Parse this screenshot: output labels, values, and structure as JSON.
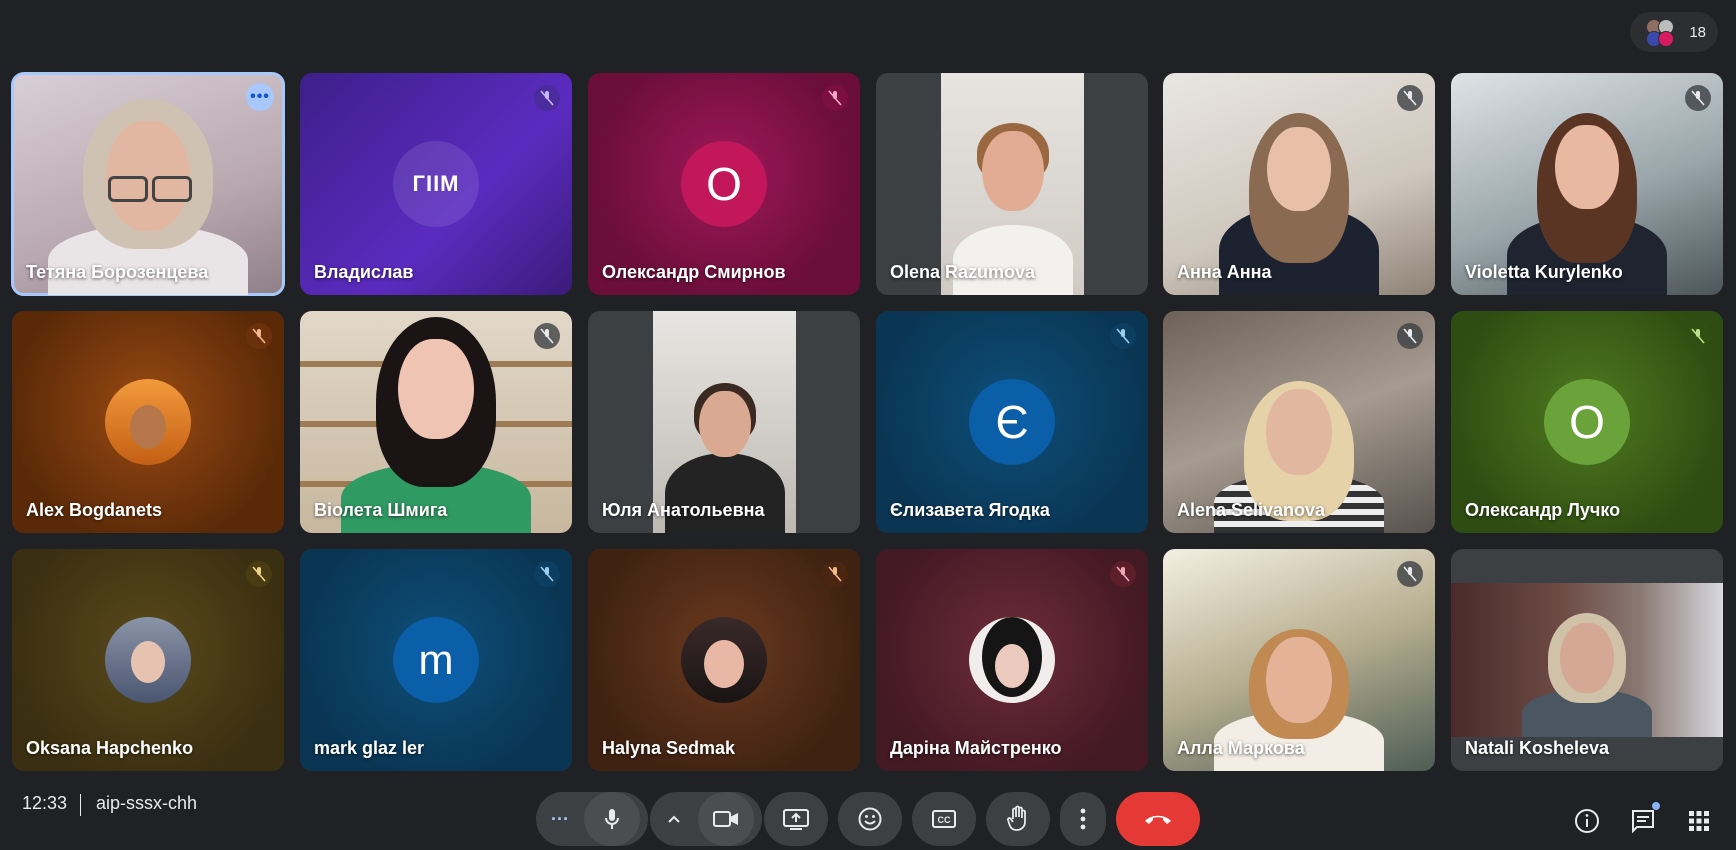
{
  "participants_count": "18",
  "meeting": {
    "time": "12:33",
    "code": "aip-sssx-chh"
  },
  "tiles": [
    {
      "name": "Тетяна Борозенцева"
    },
    {
      "name": "Владислав"
    },
    {
      "name": "Олександр Смирнов",
      "initial": "О"
    },
    {
      "name": "Olena Razumova"
    },
    {
      "name": "Анна Анна"
    },
    {
      "name": "Violetta Kurylenko"
    },
    {
      "name": "Alex Bogdanets"
    },
    {
      "name": "Віолета Шмига"
    },
    {
      "name": "Юля Анатольевна"
    },
    {
      "name": "Єлизавета Ягодка",
      "initial": "Є"
    },
    {
      "name": "Alena Selivanova"
    },
    {
      "name": "Олександр Лучко",
      "initial": "О"
    },
    {
      "name": "Oksana Hapchenko"
    },
    {
      "name": "mark glaz ler",
      "initial": "m"
    },
    {
      "name": "Halyna Sedmak"
    },
    {
      "name": "Даріна Майстренко"
    },
    {
      "name": "Алла Маркова"
    },
    {
      "name": "Natali Kosheleva"
    }
  ],
  "logo_text": "ГІІМ",
  "colors": {
    "end_call": "#e53935",
    "accent": "#a8c7fa"
  }
}
